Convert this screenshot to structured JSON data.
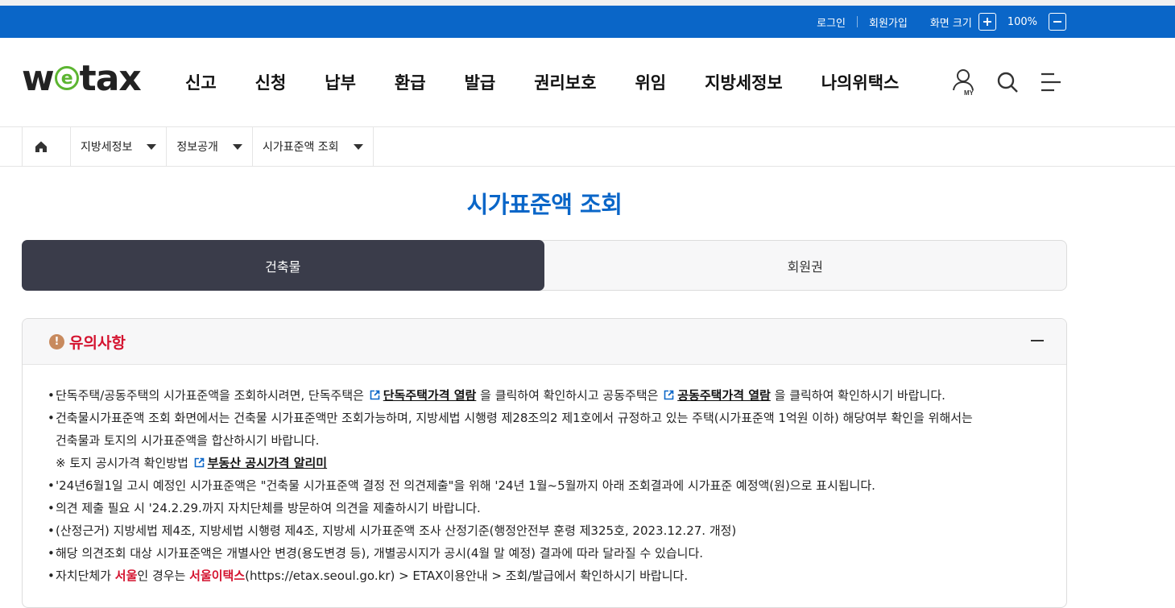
{
  "util": {
    "login": "로그인",
    "signup": "회원가입",
    "zoom_label": "화면 크기",
    "zoom_value": "100%"
  },
  "header": {
    "logo_left": "w",
    "logo_e": "e",
    "logo_right": "tax",
    "menu": [
      "신고",
      "신청",
      "납부",
      "환급",
      "발급",
      "권리보호",
      "위임",
      "지방세정보",
      "나의위택스"
    ],
    "my_label": "MY"
  },
  "breadcrumb": {
    "items": [
      "지방세정보",
      "정보공개",
      "시가표준액 조회"
    ]
  },
  "page": {
    "title": "시가표준액 조회"
  },
  "tabs": [
    {
      "label": "건축물",
      "active": true
    },
    {
      "label": "회원권",
      "active": false
    }
  ],
  "notice": {
    "title": "유의사항",
    "icon_glyph": "!",
    "bullet": "•",
    "l1_a": "단독주택/공동주택의 시가표준액을 조회하시려면, 단독주택은",
    "l1_link1": "단독주택가격 열람",
    "l1_b": "을 클릭하여 확인하시고 공동주택은",
    "l1_link2": "공동주택가격 열람",
    "l1_c": "을 클릭하여 확인하시기 바랍니다.",
    "l2": "건축물시가표준액 조회 화면에서는 건축물 시가표준액만 조회가능하며, 지방세법 시행령 제28조의2 제1호에서 규정하고 있는 주택(시가표준액 1억원 이하) 해당여부 확인을 위해서는",
    "l2b": "건축물과 토지의 시가표준액을 합산하시기 바랍니다.",
    "l3_a": "※  토지 공시가격 확인방법",
    "l3_link": "부동산 공시가격 알리미",
    "l4": "'24년6월1일 고시 예정인 시가표준액은 \"건축물 시가표준액 결정 전 의견제출\"을 위해 '24년 1월~5월까지 아래 조회결과에 시가표준 예정액(원)으로 표시됩니다.",
    "l5": "의견 제출 필요 시 '24.2.29.까지 자치단체를 방문하여 의견을 제출하시기 바랍니다.",
    "l6": "(산정근거) 지방세법 제4조, 지방세법 시행령 제4조, 지방세 시가표준액 조사 산정기준(행정안전부 훈령 제325호, 2023.12.27. 개정)",
    "l7": "해당 의견조회 대상 시가표준액은 개별사안 변경(용도변경 등), 개별공시지가 공시(4월 말 예정) 결과에 따라 달라질 수 있습니다.",
    "l8_a": "자치단체가",
    "l8_red1": "서울",
    "l8_b": "인 경우는",
    "l8_red2": "서울이택스",
    "l8_c": "(https://etax.seoul.go.kr) > ETAX이용안내 > 조회/발급에서 확인하시기 바랍니다."
  },
  "colors": {
    "brand_blue": "#0a66c8",
    "tab_active": "#3a3c4a",
    "accent_red": "#d4132f",
    "logo_green": "#5cb531"
  }
}
